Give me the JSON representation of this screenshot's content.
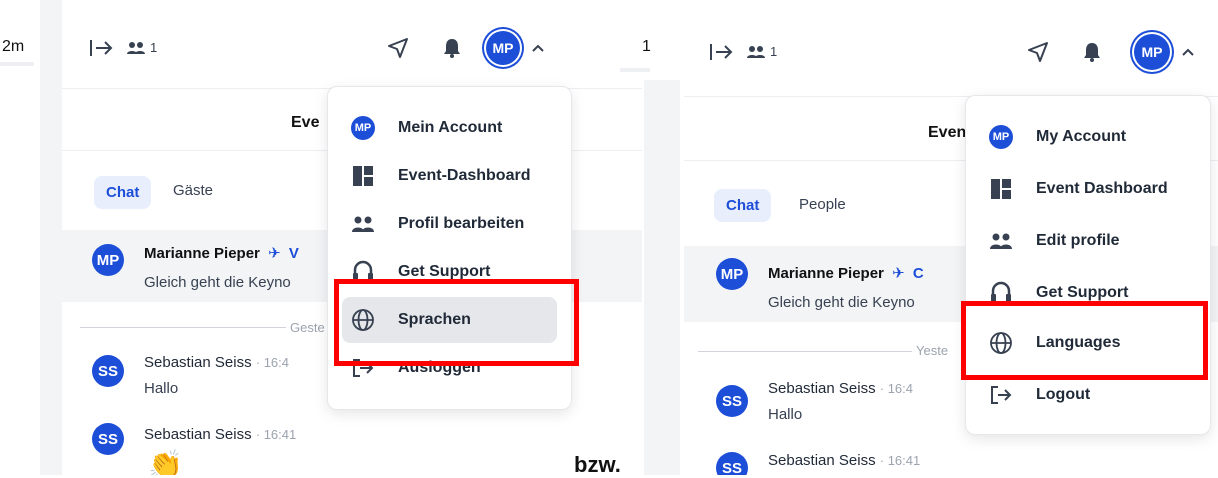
{
  "separator_text": "bzw.",
  "left_edge": {
    "time_fragment": "2m"
  },
  "mid_edge": {
    "fragment": "1"
  },
  "panel_de": {
    "participants_count": "1",
    "avatar_initials": "MP",
    "event_title_fragment": "Eve",
    "tabs": {
      "active": "Chat",
      "other": "Gäste"
    },
    "pinned": {
      "initials": "MP",
      "name": "Marianne Pieper",
      "tag_fragment": "V",
      "text": "Gleich geht die Keyno"
    },
    "divider_label": "Geste",
    "messages": [
      {
        "initials": "SS",
        "name": "Sebastian Seiss",
        "time": "· 16:4",
        "text": "Hallo"
      },
      {
        "initials": "SS",
        "name": "Sebastian Seiss",
        "time": "· 16:41",
        "text": ""
      }
    ],
    "menu": {
      "items": [
        {
          "icon": "avatar-icon",
          "label": "Mein Account"
        },
        {
          "icon": "dashboard-icon",
          "label": "Event-Dashboard"
        },
        {
          "icon": "people-icon",
          "label": "Profil bearbeiten"
        },
        {
          "icon": "headset-icon",
          "label": "Get Support"
        },
        {
          "icon": "globe-icon",
          "label": "Sprachen"
        },
        {
          "icon": "logout-icon",
          "label": "Ausloggen"
        }
      ],
      "highlighted": "Sprachen"
    }
  },
  "panel_en": {
    "participants_count": "1",
    "avatar_initials": "MP",
    "event_title_fragment": "Even",
    "tabs": {
      "active": "Chat",
      "other": "People"
    },
    "pinned": {
      "initials": "MP",
      "name": "Marianne Pieper",
      "tag_fragment": "C",
      "text": "Gleich geht die Keyno"
    },
    "divider_label": "Yeste",
    "messages": [
      {
        "initials": "SS",
        "name": "Sebastian Seiss",
        "time": "· 16:4",
        "text": "Hallo"
      },
      {
        "initials": "SS",
        "name": "Sebastian Seiss",
        "time": "· 16:41",
        "text": ""
      }
    ],
    "menu": {
      "items": [
        {
          "icon": "avatar-icon",
          "label": "My Account"
        },
        {
          "icon": "dashboard-icon",
          "label": "Event Dashboard"
        },
        {
          "icon": "people-icon",
          "label": "Edit profile"
        },
        {
          "icon": "headset-icon",
          "label": "Get Support"
        },
        {
          "icon": "globe-icon",
          "label": "Languages"
        },
        {
          "icon": "logout-icon",
          "label": "Logout"
        }
      ],
      "highlighted": "Languages"
    }
  },
  "colors": {
    "brand": "#1d4ed8",
    "highlight_box": "#ff0000",
    "hover_bg": "#e5e7eb"
  }
}
